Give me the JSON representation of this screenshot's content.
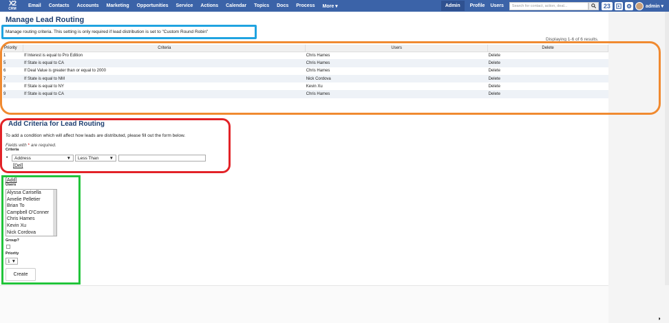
{
  "brand": {
    "logo_top": "X2",
    "logo_bottom": "CRM"
  },
  "nav": {
    "items": [
      "Email",
      "Contacts",
      "Accounts",
      "Marketing",
      "Opportunities",
      "Service",
      "Actions",
      "Calendar",
      "Topics",
      "Docs",
      "Process",
      "More ▾"
    ],
    "right": {
      "admin": "Admin",
      "profile": "Profile",
      "users": "Users"
    },
    "search_placeholder": "Search for contact, action, deal...",
    "notification_count": "23",
    "user_label": "admin ▾"
  },
  "page": {
    "title": "Manage Lead Routing",
    "description": "Manage routing criteria. This setting is only required if lead distribution is set to \"Custom Round Robin\"",
    "results": "Displaying 1-6 of 6 results."
  },
  "table": {
    "headers": [
      "Priority",
      "Criteria",
      "Users",
      "Delete"
    ],
    "rows": [
      {
        "priority": "1",
        "criteria": "If Interest is equal to Pro Edition",
        "users": "Chris Hames",
        "delete": "Delete"
      },
      {
        "priority": "5",
        "criteria": "If State is equal to CA",
        "users": "Chris Hames",
        "delete": "Delete"
      },
      {
        "priority": "6",
        "criteria": "If Deal Value is greater than or equal to 2000",
        "users": "Chris Hames",
        "delete": "Delete"
      },
      {
        "priority": "7",
        "criteria": "If State is equal to NM",
        "users": "Nick Cordova",
        "delete": "Delete"
      },
      {
        "priority": "8",
        "criteria": "If State is equal to NY",
        "users": "Kevin Xu",
        "delete": "Delete"
      },
      {
        "priority": "9",
        "criteria": "If State is equal to CA",
        "users": "Chris Hames",
        "delete": "Delete"
      }
    ]
  },
  "form": {
    "title": "Add Criteria for Lead Routing",
    "description": "To add a condition which will affect how leads are distributed, please fill out the form below.",
    "required_prefix": "Fields with ",
    "required_star": "*",
    "required_suffix": " are required.",
    "criteria_label": "Criteria",
    "field_select": "Address",
    "operator_select": "Less Than",
    "del_link": "[Del]",
    "add_link": "[Add]",
    "users_label": "Users",
    "users": [
      "Alyssa Carisella",
      "Amelie Pelletier",
      "Brian To",
      "Campbell O'Conner",
      "Chris Hames",
      "Kevin Xu",
      "Nick Cordova"
    ],
    "group_label": "Group?",
    "priority_label": "Priority",
    "priority_value": "1",
    "create_button": "Create"
  },
  "colors": {
    "nav_bg": "#3b63a8",
    "title": "#1d3e70",
    "anno_blue": "#1fa3e0",
    "anno_orange": "#f08a30",
    "anno_red": "#e22227",
    "anno_green": "#21c43a"
  }
}
